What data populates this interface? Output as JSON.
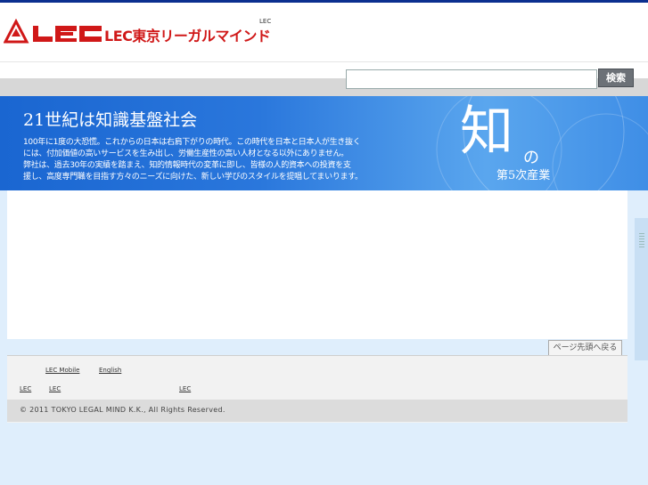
{
  "header": {
    "logo_mark": "LEC",
    "logo_name": "LEC東京リーガルマインド",
    "small_link": "LEC"
  },
  "search": {
    "placeholder": "",
    "button_label": "検索"
  },
  "hero": {
    "title": "21世紀は知識基盤社会",
    "lines": [
      "100年に1度の大恐慌。これからの日本は右肩下がりの時代。この時代を日本と日本人が生き抜く",
      "には、付加価値の高いサービスを生み出し、労働生産性の高い人材となる以外にありません。",
      "弊社は、過去30年の実績を踏まえ、知的情報時代の変革に即し、皆様の人的資本への投資を支",
      "援し、高度専門職を目指す方々のニーズに向けた、新しい学びのスタイルを提唱してまいります。"
    ],
    "big_char": "知",
    "no_char": "の",
    "subtitle": "第5次産業"
  },
  "page_top_label": "ページ先頭へ戻る",
  "footer": {
    "row1": [
      "LEC Mobile",
      "English"
    ],
    "row2": [
      "LEC",
      "LEC",
      "LEC"
    ],
    "copyright": "© 2011 TOKYO LEGAL MIND K.K., All Rights Reserved."
  }
}
